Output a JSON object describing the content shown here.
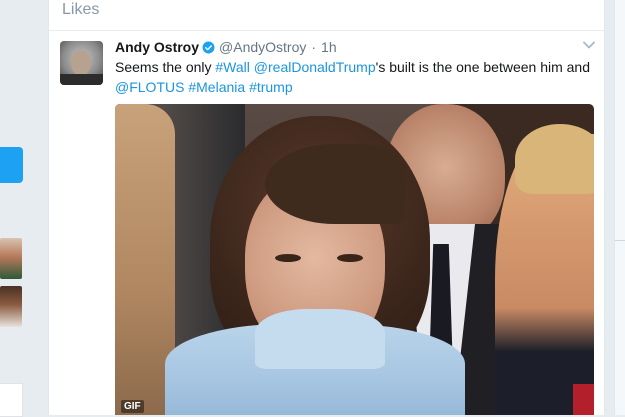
{
  "likes_header": {
    "title": "Likes"
  },
  "tweet": {
    "author_name": "Andy Ostroy",
    "handle": "@AndyOstroy",
    "separator": "·",
    "time": "1h",
    "text_parts": [
      {
        "text": "Seems the only ",
        "type": "plain"
      },
      {
        "text": "#Wall",
        "type": "link"
      },
      {
        "text": " ",
        "type": "plain"
      },
      {
        "text": "@realDonaldTrump",
        "type": "link"
      },
      {
        "text": "'s built is the one between him and ",
        "type": "plain"
      },
      {
        "text": "@FLOTUS",
        "type": "link"
      },
      {
        "text": " ",
        "type": "plain"
      },
      {
        "text": "#Melania",
        "type": "link"
      },
      {
        "text": " ",
        "type": "plain"
      },
      {
        "text": "#trump",
        "type": "link"
      }
    ],
    "media": {
      "badge": "GIF"
    }
  },
  "icons": {
    "verified": "verified-badge-icon",
    "caret": "chevron-down-icon"
  },
  "colors": {
    "link": "#1b95e0",
    "name": "#14171a",
    "muted": "#657786",
    "accent": "#1da1f2",
    "page_bg": "#e6ecf0"
  }
}
